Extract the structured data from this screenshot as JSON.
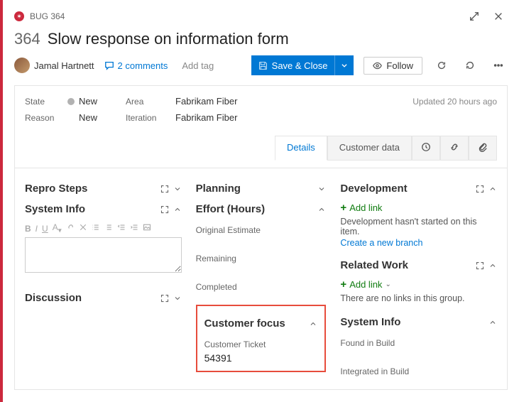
{
  "header": {
    "type_label": "BUG 364",
    "id": "364",
    "title": "Slow response on information form"
  },
  "assignee": {
    "name": "Jamal Hartnett"
  },
  "toolbar": {
    "comments": "2 comments",
    "add_tag": "Add tag",
    "save": "Save & Close",
    "follow": "Follow"
  },
  "meta": {
    "state_label": "State",
    "state": "New",
    "area_label": "Area",
    "area": "Fabrikam Fiber",
    "reason_label": "Reason",
    "reason": "New",
    "iteration_label": "Iteration",
    "iteration": "Fabrikam Fiber",
    "updated": "Updated 20 hours ago"
  },
  "tabs": {
    "details": "Details",
    "customer_data": "Customer data"
  },
  "col1": {
    "repro": "Repro Steps",
    "sysinfo": "System Info",
    "discussion": "Discussion"
  },
  "col2": {
    "planning": "Planning",
    "effort": "Effort (Hours)",
    "orig_est": "Original Estimate",
    "remaining": "Remaining",
    "completed": "Completed",
    "customer_focus": "Customer focus",
    "customer_ticket_label": "Customer Ticket",
    "customer_ticket": "54391"
  },
  "col3": {
    "development": "Development",
    "add_link": "Add link",
    "dev_hint": "Development hasn't started on this item.",
    "create_branch": "Create a new branch",
    "related_work": "Related Work",
    "no_links": "There are no links in this group.",
    "sysinfo": "System Info",
    "found_in_build": "Found in Build",
    "integrated_in_build": "Integrated in Build"
  }
}
